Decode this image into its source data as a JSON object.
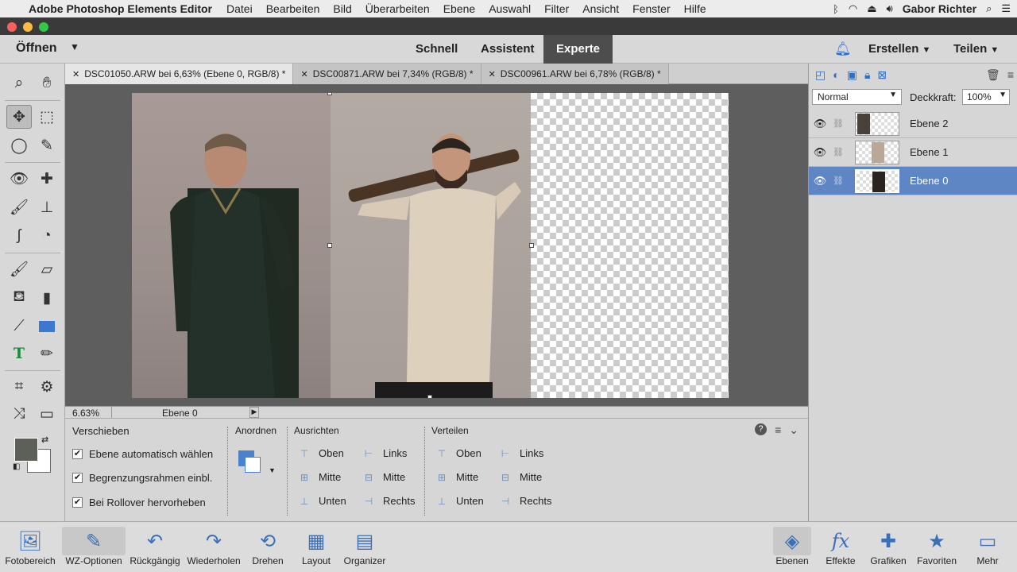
{
  "menubar": {
    "app_name": "Adobe Photoshop Elements Editor",
    "items": [
      "Datei",
      "Bearbeiten",
      "Bild",
      "Überarbeiten",
      "Ebene",
      "Auswahl",
      "Filter",
      "Ansicht",
      "Fenster",
      "Hilfe"
    ],
    "user": "Gabor Richter"
  },
  "toprow": {
    "open_label": "Öffnen",
    "modes": [
      "Schnell",
      "Assistent",
      "Experte"
    ],
    "active_mode": "Experte",
    "create_label": "Erstellen",
    "share_label": "Teilen"
  },
  "tabs": [
    {
      "label": "DSC01050.ARW bei 6,63% (Ebene 0, RGB/8) *",
      "active": true
    },
    {
      "label": "DSC00871.ARW bei 7,34% (RGB/8) *",
      "active": false
    },
    {
      "label": "DSC00961.ARW bei 6,78% (RGB/8) *",
      "active": false
    }
  ],
  "status": {
    "zoom": "6.63%",
    "layer": "Ebene 0"
  },
  "options": {
    "title": "Verschieben",
    "checks": [
      {
        "label": "Ebene automatisch wählen",
        "checked": true
      },
      {
        "label": "Begrenzungsrahmen einbl.",
        "checked": true
      },
      {
        "label": "Bei Rollover hervorheben",
        "checked": true
      }
    ],
    "arrange_title": "Anordnen",
    "align_title": "Ausrichten",
    "align_items": [
      "Oben",
      "Mitte",
      "Unten",
      "Links",
      "Mitte",
      "Rechts"
    ],
    "distribute_title": "Verteilen",
    "distribute_items": [
      "Oben",
      "Mitte",
      "Unten",
      "Links",
      "Mitte",
      "Rechts"
    ]
  },
  "layers_panel": {
    "blend_mode": "Normal",
    "opacity_label": "Deckkraft:",
    "opacity_value": "100%",
    "layers": [
      {
        "name": "Ebene 2",
        "selected": false
      },
      {
        "name": "Ebene 1",
        "selected": false
      },
      {
        "name": "Ebene 0",
        "selected": true
      }
    ]
  },
  "bottombar": {
    "left": [
      "Fotobereich",
      "WZ-Optionen",
      "Rückgängig",
      "Wiederholen",
      "Drehen",
      "Layout",
      "Organizer"
    ],
    "right": [
      "Ebenen",
      "Effekte",
      "Grafiken",
      "Favoriten",
      "Mehr"
    ]
  },
  "colors": {
    "accent": "#2d6ec7",
    "selected_layer": "#5e86c4",
    "foreground": "#5c6058"
  }
}
